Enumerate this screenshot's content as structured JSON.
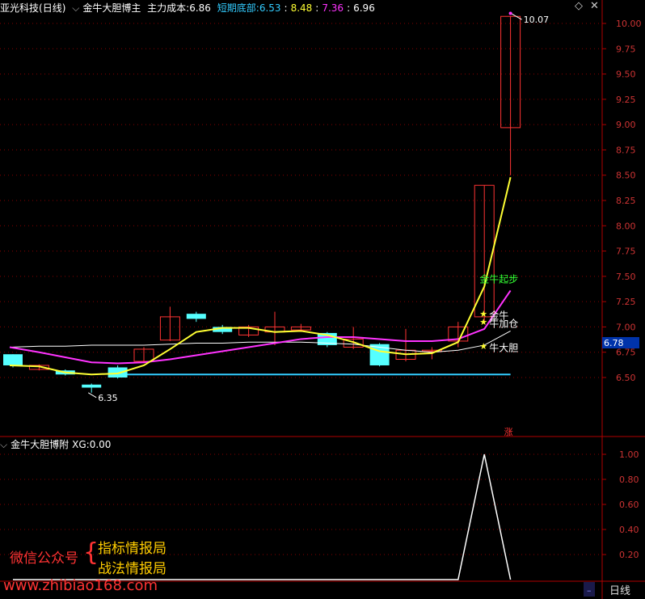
{
  "header": {
    "stock_name": "亚光科技",
    "period_label": "(日线)",
    "main_indicator": "金牛大胆博主",
    "cost_label": "主力成本:",
    "cost_value": "6.86",
    "bottom_label": "短期底部:",
    "bottom_value": "6.53",
    "sep": ":",
    "val2": "8.48",
    "val3": "7.36",
    "val4": "6.96",
    "colors": {
      "cost": "#ffffff",
      "bottom": "#33ccff",
      "val2": "#ffff33",
      "val3": "#ff33ff",
      "val4": "#ffffff"
    }
  },
  "sub_header": {
    "indicator": "金牛大胆博附",
    "xg_label": "XG:",
    "xg_value": "0.00"
  },
  "chart_data": [
    {
      "type": "candlestick",
      "yaxis_ticks": [
        "10.00",
        "9.75",
        "9.50",
        "9.25",
        "9.00",
        "8.75",
        "8.50",
        "8.25",
        "8.00",
        "7.75",
        "7.50",
        "7.25",
        "7.00",
        "6.75",
        "6.50"
      ],
      "ylim": [
        6.2,
        10.2
      ],
      "current_price": "6.78",
      "candles": [
        {
          "o": 6.73,
          "c": 6.62,
          "h": 6.73,
          "l": 6.6
        },
        {
          "o": 6.58,
          "c": 6.62,
          "h": 6.63,
          "l": 6.57
        },
        {
          "o": 6.57,
          "c": 6.53,
          "h": 6.58,
          "l": 6.52
        },
        {
          "o": 6.43,
          "c": 6.4,
          "h": 6.44,
          "l": 6.35
        },
        {
          "o": 6.6,
          "c": 6.5,
          "h": 6.62,
          "l": 6.49
        },
        {
          "o": 6.66,
          "c": 6.78,
          "h": 6.8,
          "l": 6.64
        },
        {
          "o": 6.87,
          "c": 7.1,
          "h": 7.2,
          "l": 6.86
        },
        {
          "o": 7.13,
          "c": 7.08,
          "h": 7.15,
          "l": 7.05
        },
        {
          "o": 7.0,
          "c": 6.95,
          "h": 7.02,
          "l": 6.93
        },
        {
          "o": 6.92,
          "c": 7.0,
          "h": 7.02,
          "l": 6.9
        },
        {
          "o": 6.95,
          "c": 7.0,
          "h": 7.15,
          "l": 6.82
        },
        {
          "o": 6.97,
          "c": 7.0,
          "h": 7.03,
          "l": 6.95
        },
        {
          "o": 6.94,
          "c": 6.82,
          "h": 6.95,
          "l": 6.8
        },
        {
          "o": 6.8,
          "c": 6.88,
          "h": 7.0,
          "l": 6.78
        },
        {
          "o": 6.83,
          "c": 6.62,
          "h": 6.84,
          "l": 6.61
        },
        {
          "o": 6.68,
          "c": 6.77,
          "h": 6.98,
          "l": 6.66
        },
        {
          "o": 6.76,
          "c": 6.77,
          "h": 6.8,
          "l": 6.68
        },
        {
          "o": 6.86,
          "c": 7.0,
          "h": 7.05,
          "l": 6.8
        },
        {
          "o": 7.1,
          "c": 8.4,
          "h": 8.4,
          "l": 7.05
        },
        {
          "o": 8.97,
          "c": 10.07,
          "h": 10.07,
          "l": 8.5
        }
      ],
      "yellow_line": [
        6.62,
        6.61,
        6.55,
        6.53,
        6.54,
        6.62,
        6.78,
        6.95,
        6.99,
        6.99,
        6.95,
        6.96,
        6.92,
        6.85,
        6.76,
        6.73,
        6.74,
        6.85,
        7.4,
        8.48
      ],
      "magenta_line": [
        6.8,
        6.75,
        6.7,
        6.65,
        6.64,
        6.65,
        6.68,
        6.72,
        6.76,
        6.8,
        6.84,
        6.88,
        6.9,
        6.9,
        6.88,
        6.86,
        6.86,
        6.88,
        6.98,
        7.36
      ],
      "white_line": [
        6.8,
        6.81,
        6.81,
        6.82,
        6.82,
        6.82,
        6.83,
        6.84,
        6.84,
        6.85,
        6.85,
        6.85,
        6.84,
        6.83,
        6.8,
        6.77,
        6.75,
        6.77,
        6.82,
        6.96
      ],
      "support_level": 6.53,
      "labels": {
        "high": "10.07",
        "low": "6.35",
        "start": "金牛起步",
        "bull": "金牛",
        "add": "牛加仓",
        "bold": "牛大胆",
        "rise_tag": "涨"
      }
    },
    {
      "type": "line",
      "yaxis_ticks": [
        "1.00",
        "0.80",
        "0.60",
        "0.40",
        "0.20"
      ],
      "ylim": [
        0,
        1.1
      ],
      "values": [
        0,
        0,
        0,
        0,
        0,
        0,
        0,
        0,
        0,
        0,
        0,
        0,
        0,
        0,
        0,
        0,
        0,
        0,
        1,
        0
      ]
    }
  ],
  "watermark": {
    "wechat": "微信公众号",
    "brace": "{",
    "line1": "指标情报局",
    "line2": "战法情报局",
    "site": "www.zhibiao168.com"
  },
  "footer": {
    "period_button": "日线"
  }
}
